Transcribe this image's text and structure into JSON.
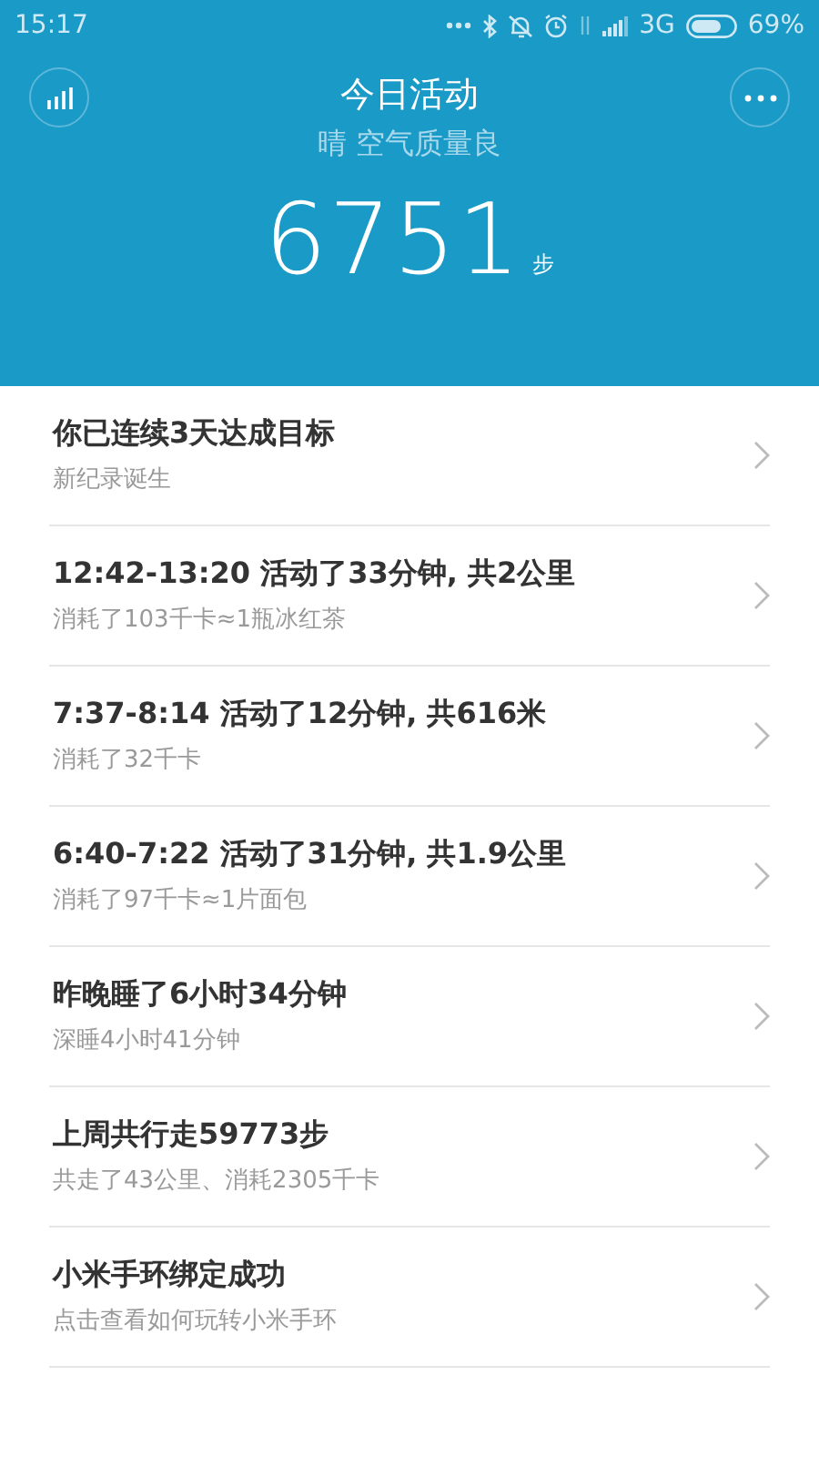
{
  "status_bar": {
    "time": "15:17",
    "network": "3G",
    "battery": "69%"
  },
  "header": {
    "title": "今日活动",
    "subtitle": "晴 空气质量良",
    "steps": "6751",
    "unit": "步"
  },
  "items": [
    {
      "title": "你已连续3天达成目标",
      "subtitle": "新纪录诞生"
    },
    {
      "title": "12:42-13:20 活动了33分钟, 共2公里",
      "subtitle": "消耗了103千卡≈1瓶冰红茶"
    },
    {
      "title": "7:37-8:14 活动了12分钟, 共616米",
      "subtitle": "消耗了32千卡"
    },
    {
      "title": "6:40-7:22 活动了31分钟, 共1.9公里",
      "subtitle": "消耗了97千卡≈1片面包"
    },
    {
      "title": "昨晚睡了6小时34分钟",
      "subtitle": "深睡4小时41分钟"
    },
    {
      "title": "上周共行走59773步",
      "subtitle": "共走了43公里、消耗2305千卡"
    },
    {
      "title": "小米手环绑定成功",
      "subtitle": "点击查看如何玩转小米手环"
    }
  ]
}
